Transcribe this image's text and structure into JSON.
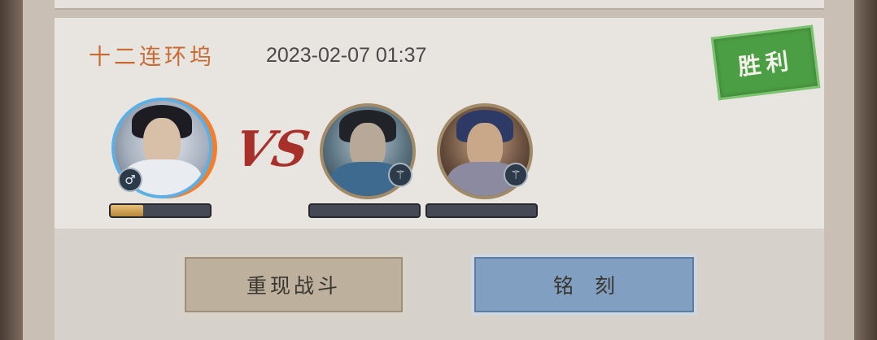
{
  "record": {
    "map_name": "十二连环坞",
    "datetime": "2023-02-07 01:37",
    "result": "胜利"
  },
  "battle": {
    "vs": "VS",
    "player": {
      "gender_symbol": "♂",
      "progress": 0.33
    },
    "enemies": [
      {
        "badge_icon": "class-emblem-icon"
      },
      {
        "badge_icon": "class-emblem-icon"
      }
    ]
  },
  "actions": {
    "replay_label": "重现战斗",
    "engrave_label": "铭刻"
  },
  "colors": {
    "map_name": "#c86a32",
    "result_stamp": "#4c9e44",
    "vs": "#a8302a",
    "progress_fill": "#d4a24f",
    "engrave_button": "#819fc0"
  }
}
